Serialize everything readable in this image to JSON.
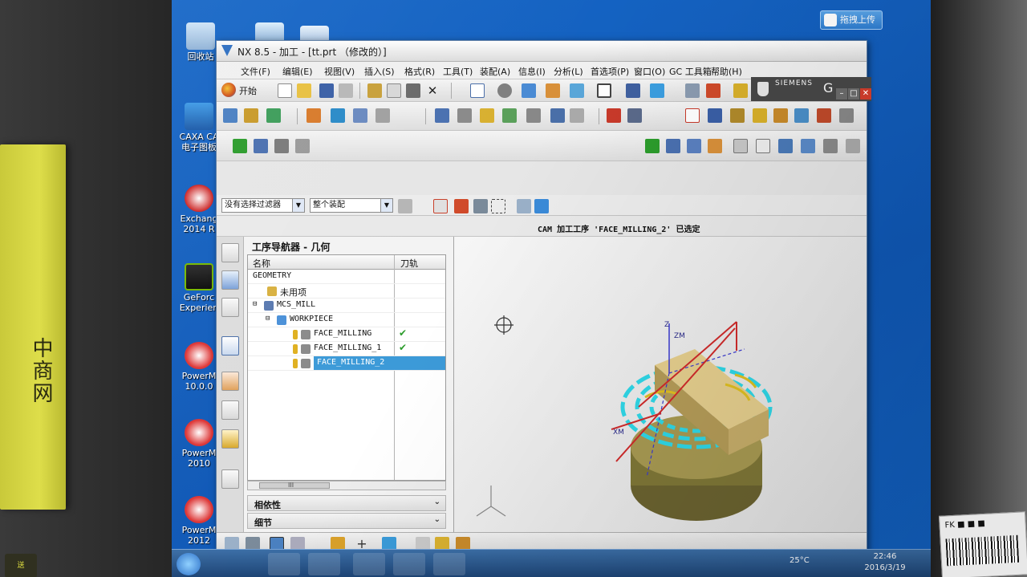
{
  "desktop": {
    "icons": [
      {
        "label": "回收站",
        "icon": "recycle-bin-icon"
      },
      {
        "label": "CAXA CA\n电子图板",
        "icon": "caxa-icon"
      },
      {
        "label": "Exchang\n2014 R",
        "icon": "exchange-icon"
      },
      {
        "label": "GeForc\nExperien",
        "icon": "geforce-icon"
      },
      {
        "label": "PowerM\n10.0.0",
        "icon": "powermill-icon"
      },
      {
        "label": "PowerM\n2010",
        "icon": "powermill-icon"
      },
      {
        "label": "PowerM\n2012",
        "icon": "powermill-icon"
      }
    ],
    "upload_label": "拖拽上传"
  },
  "window": {
    "title": "NX 8.5 - 加工 - [tt.prt （修改的）]",
    "brand": "SIEMENS",
    "brand_letter": "G"
  },
  "menu": [
    {
      "label": "文件(F)"
    },
    {
      "label": "编辑(E)"
    },
    {
      "label": "视图(V)"
    },
    {
      "label": "插入(S)"
    },
    {
      "label": "格式(R)"
    },
    {
      "label": "工具(T)"
    },
    {
      "label": "装配(A)"
    },
    {
      "label": "信息(I)"
    },
    {
      "label": "分析(L)"
    },
    {
      "label": "首选项(P)"
    },
    {
      "label": "窗口(O)"
    },
    {
      "label": "GC 工具箱"
    },
    {
      "label": "帮助(H)"
    }
  ],
  "toolbar": {
    "start_label": "开始"
  },
  "filter": {
    "selection_filter": "没有选择过滤器",
    "scope": "整个装配"
  },
  "status": {
    "message": "CAM 加工工序 'FACE_MILLING_2' 已选定"
  },
  "navigator": {
    "title": "工序导航器 - 几何",
    "columns": {
      "name": "名称",
      "path": "刀轨"
    },
    "rows": [
      {
        "label": "GEOMETRY",
        "indent": 0,
        "check": ""
      },
      {
        "label": "未用项",
        "indent": 1,
        "check": ""
      },
      {
        "label": "MCS_MILL",
        "indent": 1,
        "check": ""
      },
      {
        "label": "WORKPIECE",
        "indent": 2,
        "check": ""
      },
      {
        "label": "FACE_MILLING",
        "indent": 3,
        "check": "✔"
      },
      {
        "label": "FACE_MILLING_1",
        "indent": 3,
        "check": "✔"
      },
      {
        "label": "FACE_MILLING_2",
        "indent": 3,
        "check": ""
      }
    ],
    "scroll_mark": "III",
    "panels": {
      "dependencies": "相依性",
      "details": "细节"
    }
  },
  "viewport": {
    "axis_z": "Z",
    "axis_zm": "ZM",
    "axis_xm": "XM"
  },
  "taskbar": {
    "temperature": "25°C",
    "time": "22:46",
    "date": "2016/3/19"
  },
  "photo": {
    "box_text": "中商网",
    "box_badge": "送",
    "sticker_text": "FK ■ ■ ■"
  }
}
